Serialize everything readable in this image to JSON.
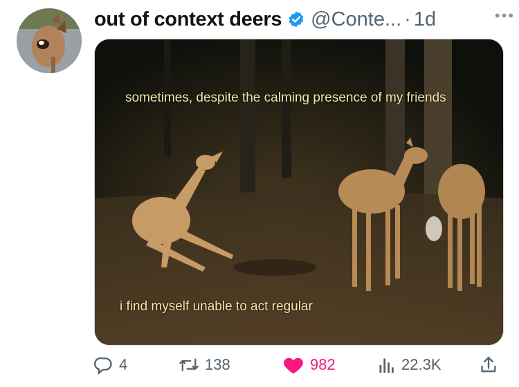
{
  "tweet": {
    "display_name": "out of context deers",
    "handle": "@Conte...",
    "separator": "·",
    "time": "1d",
    "more_label": "•••",
    "captions": {
      "top": "sometimes, despite the calming presence of my friends",
      "bottom": "i find myself unable to act regular"
    },
    "metrics": {
      "replies": "4",
      "retweets": "138",
      "likes": "982",
      "views": "22.3K"
    },
    "liked": true
  },
  "colors": {
    "accent_blue": "#1d9bf0",
    "like_pink": "#f91880",
    "muted_text": "#536471",
    "caption_yellow": "#f0e8a8"
  }
}
